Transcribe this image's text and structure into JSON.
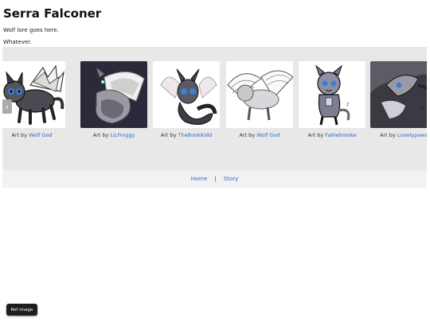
{
  "page": {
    "title": "Serra Falconer",
    "paragraphs": [
      "Wolf lore goes here.",
      "Whatever."
    ]
  },
  "carousel": {
    "prev_icon": "‹",
    "next_icon": "›",
    "caption_prefix": "Art by",
    "slides": [
      {
        "artist": "Wolf God"
      },
      {
        "artist": "LiLFroggy"
      },
      {
        "artist": "TheBookKidd"
      },
      {
        "artist": "Wolf God"
      },
      {
        "artist": "Fablebrooke"
      },
      {
        "artist": "Lonelypaws"
      }
    ]
  },
  "footer": {
    "links": [
      "Home",
      "Story"
    ],
    "separator": "|"
  },
  "ref_button": {
    "label": "Ref image"
  },
  "colors": {
    "link": "#2a6cc4",
    "carousel_bg": "#e8e8e8",
    "footer_bg": "#f2f2f2"
  }
}
